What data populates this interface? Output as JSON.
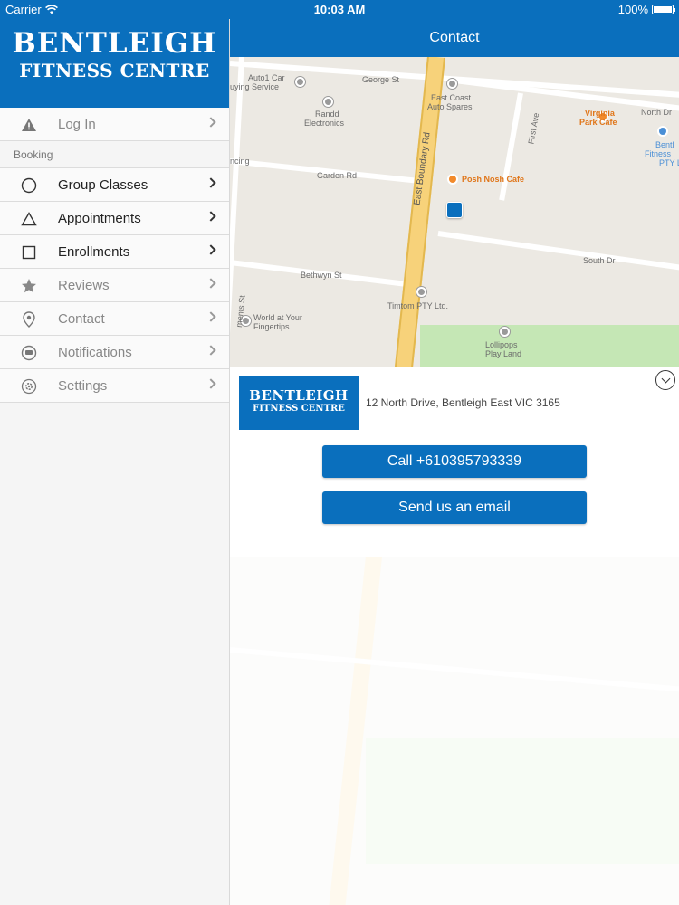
{
  "status_bar": {
    "carrier": "Carrier",
    "time": "10:03 AM",
    "battery": "100%"
  },
  "brand": {
    "line1": "BENTLEIGH",
    "line2": "FITNESS CENTRE"
  },
  "sidebar": {
    "top_items": [
      {
        "label": "Log In",
        "icon": "warning-icon",
        "active": false
      }
    ],
    "section_label": "Booking",
    "items": [
      {
        "label": "Group Classes",
        "icon": "circle-icon",
        "active": true
      },
      {
        "label": "Appointments",
        "icon": "triangle-icon",
        "active": true
      },
      {
        "label": "Enrollments",
        "icon": "square-icon",
        "active": true
      },
      {
        "label": "Reviews",
        "icon": "star-icon",
        "active": false
      },
      {
        "label": "Contact",
        "icon": "location-pin-icon",
        "active": false
      },
      {
        "label": "Notifications",
        "icon": "chat-bubble-icon",
        "active": false
      },
      {
        "label": "Settings",
        "icon": "gear-icon",
        "active": false
      }
    ]
  },
  "header": {
    "title": "Contact"
  },
  "map": {
    "labels": {
      "auto1": "Auto1 Car",
      "auto1b": "uying Service",
      "george": "George St",
      "eastcoast": "East Coast",
      "eastcoastb": "Auto Spares",
      "randd": "Randd",
      "randdb": "Electronics",
      "virginia": "Virginia",
      "virginiab": "Park Cafe",
      "northdr": "North Dr",
      "bentleigh_map": "Bentl",
      "bentleigh_map2": "Fitness",
      "bentleigh_map3": "PTY L",
      "firstave": "First Ave",
      "eastboundary": "East Boundary Rd",
      "poshnosh": "Posh Nosh Cafe",
      "garden": "Garden Rd",
      "ncing": "ncing",
      "southdr": "South Dr",
      "bethwyn": "Bethwyn St",
      "timtom": "Timtom PTY Ltd.",
      "worldat": "World at Your",
      "worldatb": "Fingertips",
      "lollipops": "Lollipops",
      "lollipopsb": "Play Land",
      "ments": "ments St"
    }
  },
  "info": {
    "logo_line1": "BENTLEIGH",
    "logo_line2": "FITNESS CENTRE",
    "address": "12 North Drive, Bentleigh East VIC 3165",
    "call_label": "Call +610395793339",
    "email_label": "Send us an email"
  },
  "colors": {
    "brand_blue": "#0a6fbd",
    "major_road": "#f7d27a",
    "park": "#c5e7b5"
  }
}
